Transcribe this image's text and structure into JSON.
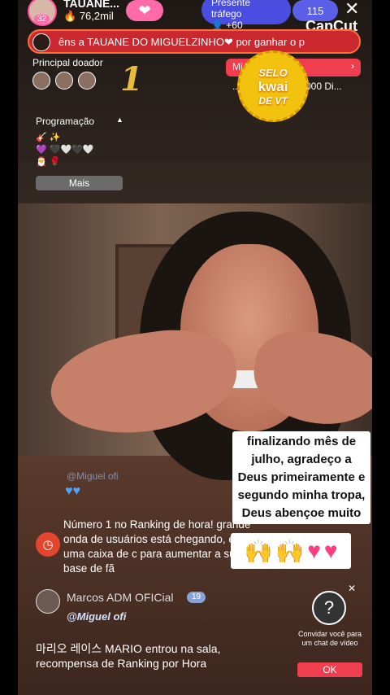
{
  "host": {
    "name": "TAUANE...",
    "level": "32",
    "likes": "76,2mil"
  },
  "traffic": {
    "title": "Presente tráfego",
    "count": "+60"
  },
  "viewers": "115",
  "watermark": "CapCut",
  "marquee": "êns a TAUANE DO MIGUELZINHO❤ por ganhar o p",
  "top_donor": {
    "title": "Principal doador",
    "rank": "1"
  },
  "mission": {
    "label": "Mi",
    "line1": "...",
    "line2": "000 Di..."
  },
  "seal": {
    "line1": "SELO",
    "line2": "kwai",
    "line3": "DE VT"
  },
  "programacao": {
    "title": "Programação",
    "more": "Mais"
  },
  "caption": {
    "text": "finalizando mês de julho, agradeço a Deus primeiramente e segundo minha tropa, Deus abençoe muito"
  },
  "faded_chat": {
    "text": "@Miguel ofi"
  },
  "notice": {
    "text": "Número 1 no Ranking de hora! grande onda de usuários está chegando, envie uma caixa de c para aumentar a sua base de fã"
  },
  "message1": {
    "name": "Marcos ADM OFICial",
    "badge": "19",
    "body": "@Miguel ofi"
  },
  "message2": {
    "text": "마리오 레이스 MARIO entrou na sala, recompensa de Ranking por Hora"
  },
  "invite": {
    "text": "Convidar você para um chat de vídeo",
    "ok": "OK"
  },
  "icons": [
    "flame-icon",
    "gift-icon",
    "person-icon",
    "close-icon",
    "chevron-right-icon",
    "clock-icon",
    "question-icon"
  ]
}
